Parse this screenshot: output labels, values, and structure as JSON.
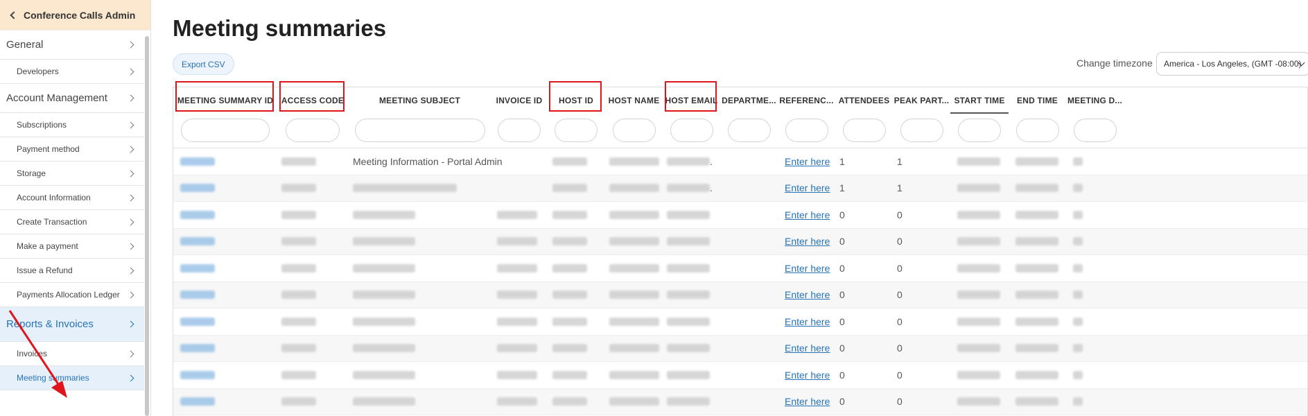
{
  "sidebar": {
    "header": "Conference Calls Admin",
    "items": [
      {
        "label": "General",
        "type": "section"
      },
      {
        "label": "Developers",
        "type": "sub"
      },
      {
        "label": "Account Management",
        "type": "section"
      },
      {
        "label": "Subscriptions",
        "type": "sub"
      },
      {
        "label": "Payment method",
        "type": "sub"
      },
      {
        "label": "Storage",
        "type": "sub"
      },
      {
        "label": "Account Information",
        "type": "sub"
      },
      {
        "label": "Create Transaction",
        "type": "sub"
      },
      {
        "label": "Make a payment",
        "type": "sub"
      },
      {
        "label": "Issue a Refund",
        "type": "sub"
      },
      {
        "label": "Payments Allocation Ledger",
        "type": "sub"
      },
      {
        "label": "Reports & Invoices",
        "type": "section",
        "active": true
      },
      {
        "label": "Invoices",
        "type": "sub"
      },
      {
        "label": "Meeting summaries",
        "type": "sub",
        "active": true
      }
    ]
  },
  "main": {
    "title": "Meeting summaries",
    "export_label": "Export CSV",
    "timezone_label": "Change timezone",
    "timezone_value": "America - Los Angeles, (GMT -08:00)"
  },
  "table": {
    "columns": [
      {
        "label": "MEETING SUMMARY ID",
        "highlighted": true
      },
      {
        "label": "ACCESS CODE",
        "highlighted": true
      },
      {
        "label": "MEETING SUBJECT"
      },
      {
        "label": "INVOICE ID"
      },
      {
        "label": "HOST ID",
        "highlighted": true
      },
      {
        "label": "HOST NAME"
      },
      {
        "label": "HOST EMAIL",
        "highlighted": true
      },
      {
        "label": "DEPARTME..."
      },
      {
        "label": "REFERENC..."
      },
      {
        "label": "ATTENDEES"
      },
      {
        "label": "PEAK PART..."
      },
      {
        "label": "START TIME",
        "sorted": true
      },
      {
        "label": "END TIME"
      },
      {
        "label": "MEETING D..."
      }
    ],
    "rows": [
      {
        "subject": "Meeting Information - Portal Admin",
        "email_suffix": ".",
        "reference": "Enter here",
        "attendees": "1",
        "peak": "1"
      },
      {
        "subject": "",
        "email_suffix": ".",
        "reference": "Enter here",
        "attendees": "1",
        "peak": "1"
      },
      {
        "subject": "",
        "email_suffix": "",
        "reference": "Enter here",
        "attendees": "0",
        "peak": "0"
      },
      {
        "subject": "",
        "email_suffix": "",
        "reference": "Enter here",
        "attendees": "0",
        "peak": "0"
      },
      {
        "subject": "",
        "email_suffix": "",
        "reference": "Enter here",
        "attendees": "0",
        "peak": "0"
      },
      {
        "subject": "",
        "email_suffix": "",
        "reference": "Enter here",
        "attendees": "0",
        "peak": "0"
      },
      {
        "subject": "",
        "email_suffix": "",
        "reference": "Enter here",
        "attendees": "0",
        "peak": "0"
      },
      {
        "subject": "",
        "email_suffix": "",
        "reference": "Enter here",
        "attendees": "0",
        "peak": "0"
      },
      {
        "subject": "",
        "email_suffix": "",
        "reference": "Enter here",
        "attendees": "0",
        "peak": "0"
      },
      {
        "subject": "",
        "email_suffix": "",
        "reference": "Enter here",
        "attendees": "0",
        "peak": "0"
      }
    ]
  },
  "colors": {
    "accent": "#2773b5",
    "sidebar_header_bg": "#fbe8cf",
    "annotation_red": "#e0151b"
  }
}
